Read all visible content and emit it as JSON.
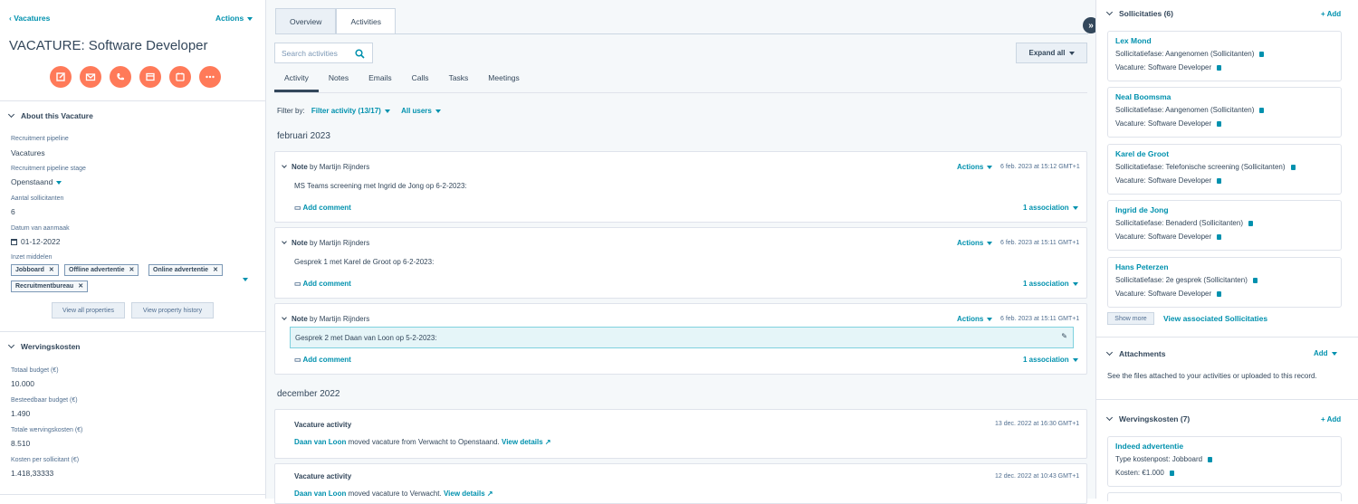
{
  "left": {
    "back_link": "Vacatures",
    "actions": "Actions",
    "title": "VACATURE: Software Developer",
    "about_header": "About this Vacature",
    "properties": [
      {
        "label": "Recruitment pipeline",
        "value": "Vacatures"
      },
      {
        "label": "Recruitment pipeline stage",
        "value": "Openstaand"
      },
      {
        "label": "Aantal sollicitanten",
        "value": "6"
      },
      {
        "label": "Datum van aanmaak",
        "value": "01-12-2022"
      },
      {
        "label": "Inzet middelen",
        "value": ""
      }
    ],
    "tags": [
      "Jobboard",
      "Offline advertentie",
      "Online advertentie",
      "Recruitmentbureau"
    ],
    "view_all": "View all properties",
    "view_history": "View property history",
    "werving_header": "Wervingskosten",
    "costs": [
      {
        "label": "Totaal budget (€)",
        "value": "10.000"
      },
      {
        "label": "Besteedbaar budget (€)",
        "value": "1.490"
      },
      {
        "label": "Totale wervingskosten (€)",
        "value": "8.510"
      },
      {
        "label": "Kosten per sollicitant (€)",
        "value": "1.418,33333"
      }
    ]
  },
  "mid": {
    "tabs": [
      "Overview",
      "Activities"
    ],
    "search_placeholder": "Search activities",
    "expand_all": "Expand all",
    "subtabs": [
      "Activity",
      "Notes",
      "Emails",
      "Calls",
      "Tasks",
      "Meetings"
    ],
    "filter_by": "Filter by:",
    "filter_activity": "Filter activity (13/17)",
    "all_users": "All users",
    "month1": "februari 2023",
    "month2": "december 2022",
    "notes": [
      {
        "type": "Note",
        "by": "by Martijn Rijnders",
        "actions": "Actions",
        "time": "6 feb. 2023 at 15:12 GMT+1",
        "body": "MS Teams screening met Ingrid de Jong op 6-2-2023:",
        "comment": "Add comment",
        "assoc": "1 association"
      },
      {
        "type": "Note",
        "by": "by Martijn Rijnders",
        "actions": "Actions",
        "time": "6 feb. 2023 at 15:11 GMT+1",
        "body": "Gesprek 1 met Karel de Groot op 6-2-2023:",
        "comment": "Add comment",
        "assoc": "1 association"
      },
      {
        "type": "Note",
        "by": "by Martijn Rijnders",
        "actions": "Actions",
        "time": "6 feb. 2023 at 15:11 GMT+1",
        "body": "Gesprek 2 met Daan van Loon op 5-2-2023:",
        "comment": "Add comment",
        "assoc": "1 association"
      }
    ],
    "activities": [
      {
        "title": "Vacature activity",
        "time": "13 dec. 2022 at 16:30 GMT+1",
        "who": "Daan van Loon",
        "text": "moved vacature from Verwacht to Openstaand.",
        "link": "View details"
      },
      {
        "title": "Vacature activity",
        "time": "12 dec. 2022 at 10:43 GMT+1",
        "who": "Daan van Loon",
        "text": "moved vacature to Verwacht.",
        "link": "View details"
      }
    ]
  },
  "right": {
    "soll_header": "Sollicitaties (6)",
    "add": "+ Add",
    "soll": [
      {
        "name": "Lex Mond",
        "fase_label": "Sollicitatiefase:",
        "fase": "Aangenomen (Sollicitanten)",
        "vac_label": "Vacature:",
        "vac": "Software Developer"
      },
      {
        "name": "Neal Boomsma",
        "fase_label": "Sollicitatiefase:",
        "fase": "Aangenomen (Sollicitanten)",
        "vac_label": "Vacature:",
        "vac": "Software Developer"
      },
      {
        "name": "Karel de Groot",
        "fase_label": "Sollicitatiefase:",
        "fase": "Telefonische screening (Sollicitanten)",
        "vac_label": "Vacature:",
        "vac": "Software Developer"
      },
      {
        "name": "Ingrid de Jong",
        "fase_label": "Sollicitatiefase:",
        "fase": "Benaderd (Sollicitanten)",
        "vac_label": "Vacature:",
        "vac": "Software Developer"
      },
      {
        "name": "Hans Peterzen",
        "fase_label": "Sollicitatiefase:",
        "fase": "2e gesprek (Sollicitanten)",
        "vac_label": "Vacature:",
        "vac": "Software Developer"
      }
    ],
    "show_more": "Show more",
    "view_assoc": "View associated Sollicitaties",
    "attach_header": "Attachments",
    "attach_add": "Add",
    "attach_text": "See the files attached to your activities or uploaded to this record.",
    "werving_header": "Wervingskosten (7)",
    "werving_add": "+ Add",
    "werving_card": {
      "name": "Indeed advertentie",
      "type_label": "Type kostenpost:",
      "type": "Jobboard",
      "cost_label": "Kosten:",
      "cost": "€1.000"
    }
  }
}
